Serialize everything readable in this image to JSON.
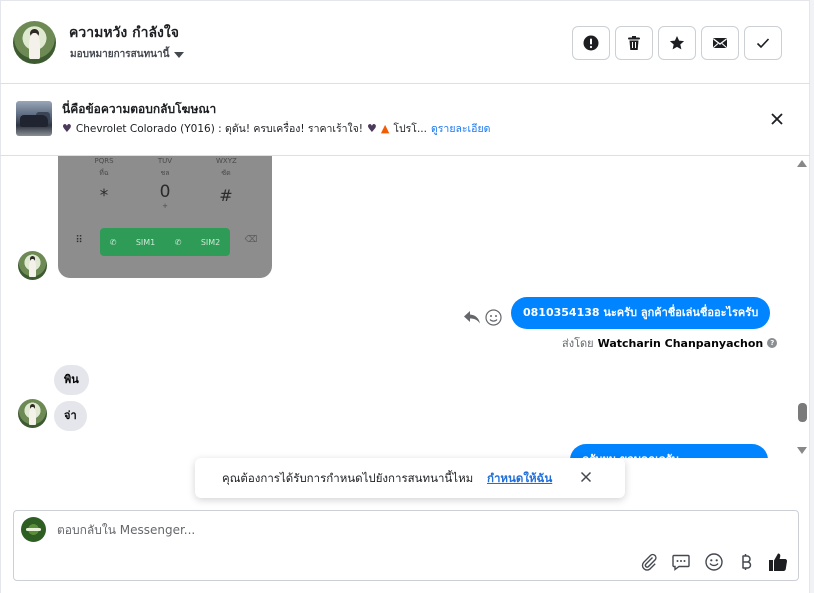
{
  "header": {
    "contact_name": "ความหวัง กำลังใจ",
    "assign_label": "มอบหมายการสนทนานี้",
    "actions": [
      {
        "name": "report-button",
        "icon": "exclamation-circle-icon"
      },
      {
        "name": "delete-button",
        "icon": "trash-icon"
      },
      {
        "name": "star-button",
        "icon": "star-icon"
      },
      {
        "name": "mark-unread-button",
        "icon": "envelope-icon"
      },
      {
        "name": "mark-done-button",
        "icon": "checkmark-icon"
      }
    ]
  },
  "ad": {
    "title": "นี่คือข้อความตอบกลับโฆษณา",
    "description": "Chevrolet Colorado (Y016) : ดุดัน! ครบเครื่อง! ราคาเร้าใจ!",
    "promo": "โปรโ...",
    "details_link": "ดูรายละเอียด"
  },
  "phone_image": {
    "keys_top": [
      "PQRS",
      "TUV",
      "WXYZ"
    ],
    "keys_top_sub": [
      "ที่ฉ",
      "ชล",
      "ซัด"
    ],
    "symbols": [
      "*",
      "0",
      "#"
    ],
    "zero_sub": "+",
    "sim1": "SIM1",
    "sim2": "SIM2"
  },
  "messages": {
    "outgoing_1": "0810354138 นะครับ ลูกค้าชื่อเล่นชื่ออะไรครับ",
    "sent_by_prefix": "ส่งโดย",
    "sent_by_name": "Watcharin Chanpanyachon",
    "incoming_1": "พิน",
    "incoming_2": "จ่า",
    "outgoing_2": "ครับผม ขอบคุณครับ"
  },
  "toast": {
    "text": "คุณต้องการได้รับการกำหนดไปยังการสนทนานี้ไหม",
    "link": "กำหนดให้ฉัน"
  },
  "composer": {
    "placeholder": "ตอบกลับใน Messenger..."
  },
  "colors": {
    "accent": "#0084ff",
    "link": "#216fdb",
    "call_green": "#2e9b57"
  }
}
